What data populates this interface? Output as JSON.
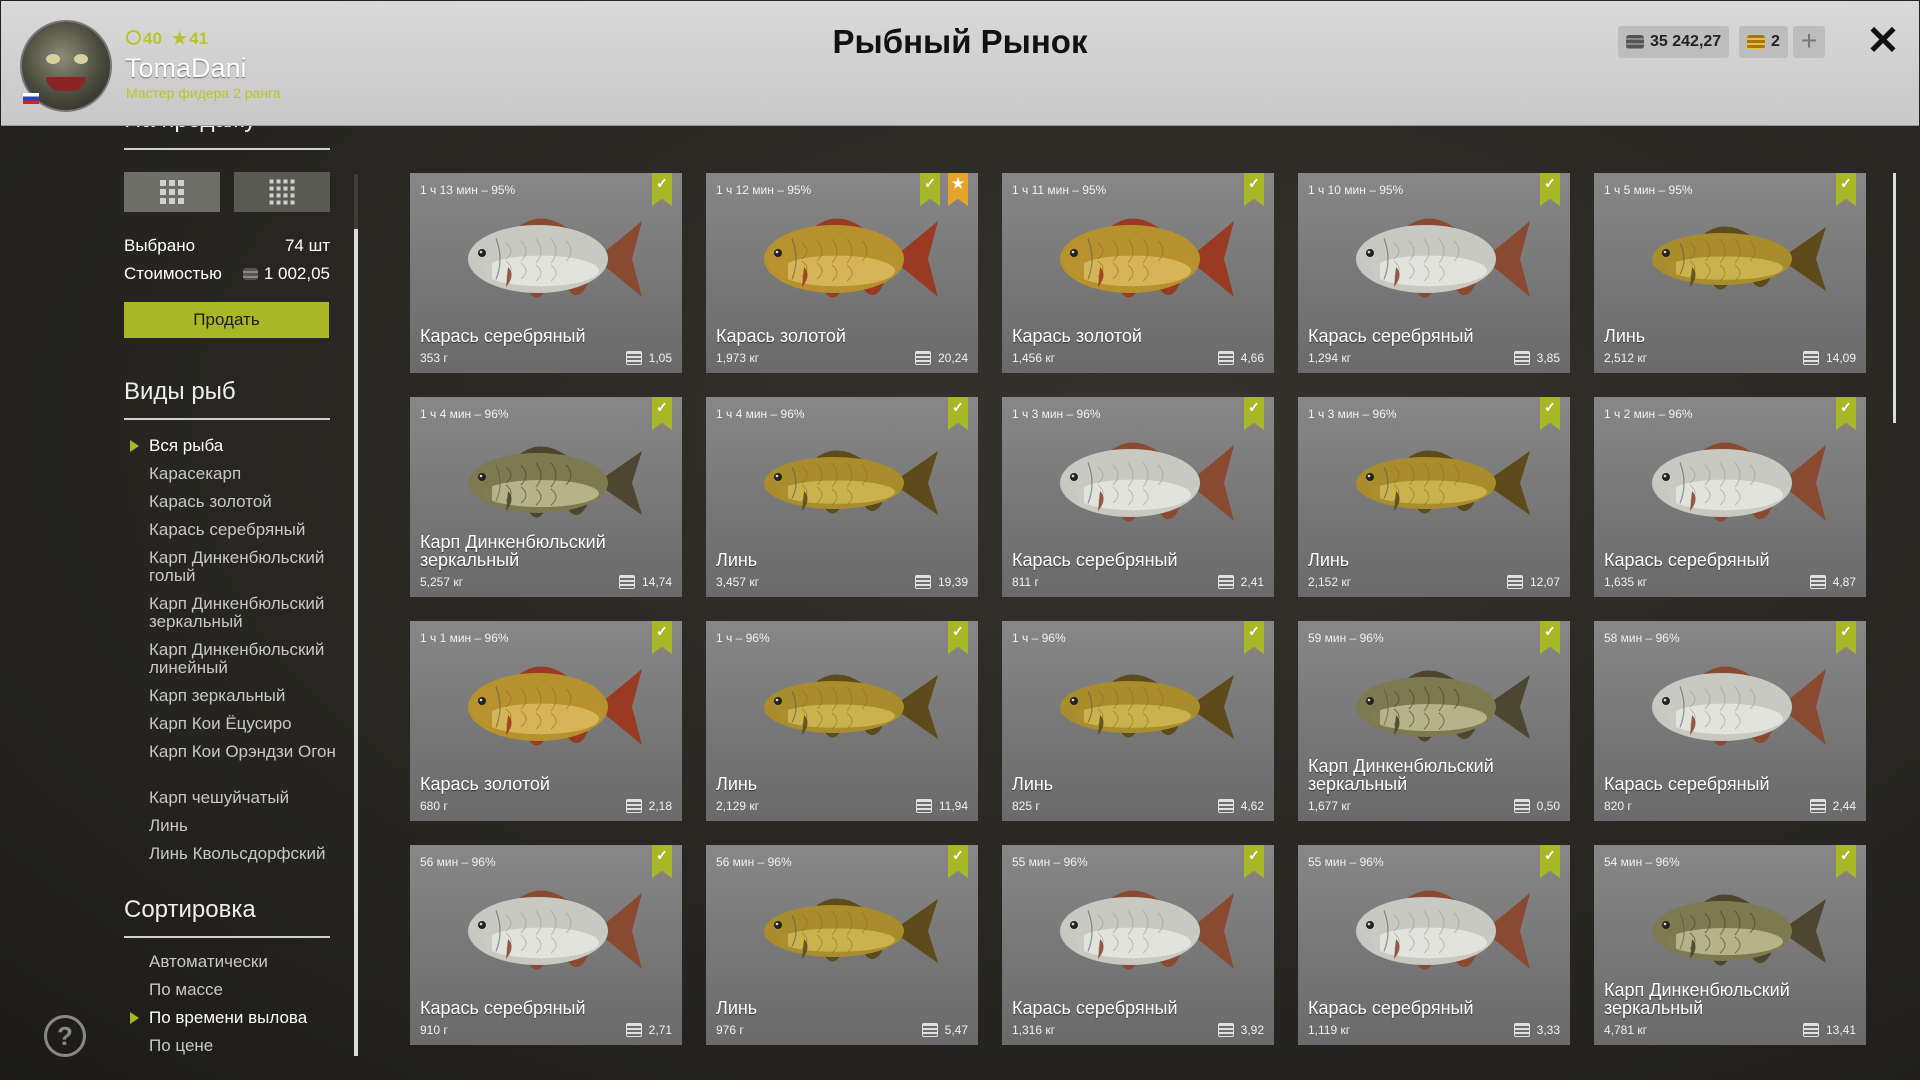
{
  "player": {
    "level": "40",
    "stars": "41",
    "name": "TomaDani",
    "rank": "Мастер фидера 2 ранга"
  },
  "title": "Рыбный Рынок",
  "wallet": {
    "silver": "35 242,27",
    "gold": "2",
    "add": "+",
    "close": "✕"
  },
  "sidebar": {
    "section_sale": "На продажу",
    "selected_label": "Выбрано",
    "selected_value": "74 шт",
    "cost_label": "Стоимостью",
    "cost_value": "1 002,05",
    "sell_button": "Продать",
    "section_species": "Виды рыб",
    "species": [
      "Вся рыба",
      "Карасекарп",
      "Карась золотой",
      "Карась серебряный",
      "Карп Динкенбюльский голый",
      "Карп Динкенбюльский зеркальный",
      "Карп Динкенбюльский линейный",
      "Карп зеркальный",
      "Карп Кои Ёцусиро",
      "Карп Кои Орэндзи Огон",
      "Карп чешуйчатый",
      "Линь",
      "Линь Квольсдорфский"
    ],
    "species_active": 0,
    "section_sort": "Сортировка",
    "sort": [
      "Автоматически",
      "По массе",
      "По времени вылова",
      "По цене"
    ],
    "sort_active": 2,
    "help": "?"
  },
  "colors": {
    "accent": "#a7b725",
    "favorite": "#e6a52a"
  },
  "cards": [
    {
      "time": "1 ч 13 мин – 95%",
      "name": "Карась серебряный",
      "weight": "353 г",
      "price": "1,05",
      "type": "silver",
      "fav": false
    },
    {
      "time": "1 ч 12 мин – 95%",
      "name": "Карась золотой",
      "weight": "1,973 кг",
      "price": "20,24",
      "type": "gold",
      "fav": true
    },
    {
      "time": "1 ч 11 мин – 95%",
      "name": "Карась золотой",
      "weight": "1,456 кг",
      "price": "4,66",
      "type": "gold",
      "fav": false
    },
    {
      "time": "1 ч 10 мин – 95%",
      "name": "Карась серебряный",
      "weight": "1,294 кг",
      "price": "3,85",
      "type": "silver",
      "fav": false
    },
    {
      "time": "1 ч 5 мин – 95%",
      "name": "Линь",
      "weight": "2,512 кг",
      "price": "14,09",
      "type": "tench",
      "fav": false
    },
    {
      "time": "1 ч 4 мин – 96%",
      "name": "Карп Динкенбюльский зеркальный",
      "weight": "5,257 кг",
      "price": "14,74",
      "type": "carp",
      "fav": false
    },
    {
      "time": "1 ч 4 мин – 96%",
      "name": "Линь",
      "weight": "3,457 кг",
      "price": "19,39",
      "type": "tench",
      "fav": false
    },
    {
      "time": "1 ч 3 мин – 96%",
      "name": "Карась серебряный",
      "weight": "811 г",
      "price": "2,41",
      "type": "silver",
      "fav": false
    },
    {
      "time": "1 ч 3 мин – 96%",
      "name": "Линь",
      "weight": "2,152 кг",
      "price": "12,07",
      "type": "tench",
      "fav": false
    },
    {
      "time": "1 ч 2 мин – 96%",
      "name": "Карась серебряный",
      "weight": "1,635 кг",
      "price": "4,87",
      "type": "silver",
      "fav": false
    },
    {
      "time": "1 ч 1 мин – 96%",
      "name": "Карась золотой",
      "weight": "680 г",
      "price": "2,18",
      "type": "gold",
      "fav": false
    },
    {
      "time": "1 ч – 96%",
      "name": "Линь",
      "weight": "2,129 кг",
      "price": "11,94",
      "type": "tench",
      "fav": false
    },
    {
      "time": "1 ч – 96%",
      "name": "Линь",
      "weight": "825 г",
      "price": "4,62",
      "type": "tench",
      "fav": false
    },
    {
      "time": "59 мин – 96%",
      "name": "Карп Динкенбюльский зеркальный",
      "weight": "1,677 кг",
      "price": "0,50",
      "type": "carp",
      "fav": false
    },
    {
      "time": "58 мин – 96%",
      "name": "Карась серебряный",
      "weight": "820 г",
      "price": "2,44",
      "type": "silver",
      "fav": false
    },
    {
      "time": "56 мин – 96%",
      "name": "Карась серебряный",
      "weight": "910 г",
      "price": "2,71",
      "type": "silver",
      "fav": false
    },
    {
      "time": "56 мин – 96%",
      "name": "Линь",
      "weight": "976 г",
      "price": "5,47",
      "type": "tench",
      "fav": false
    },
    {
      "time": "55 мин – 96%",
      "name": "Карась серебряный",
      "weight": "1,316 кг",
      "price": "3,92",
      "type": "silver",
      "fav": false
    },
    {
      "time": "55 мин – 96%",
      "name": "Карась серебряный",
      "weight": "1,119 кг",
      "price": "3,33",
      "type": "silver",
      "fav": false
    },
    {
      "time": "54 мин – 96%",
      "name": "Карп Динкенбюльский зеркальный",
      "weight": "4,781 кг",
      "price": "13,41",
      "type": "carp",
      "fav": false
    }
  ]
}
